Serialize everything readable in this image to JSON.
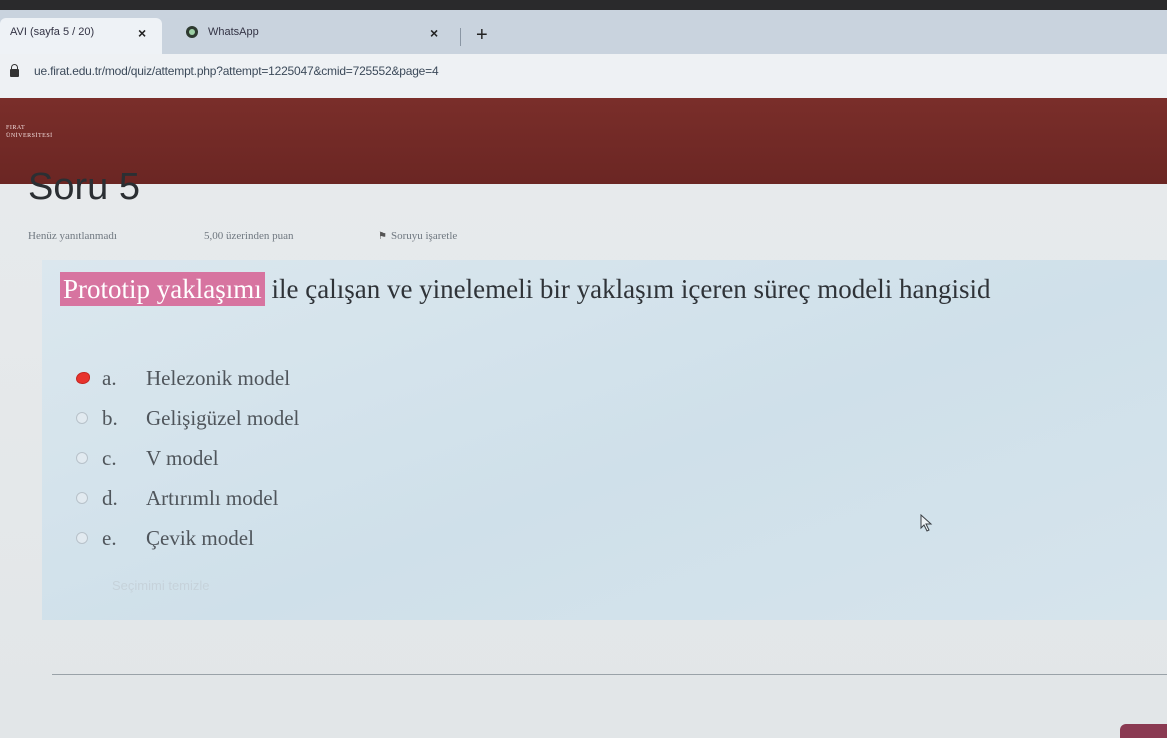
{
  "browser": {
    "tabs": [
      {
        "title": "AVI (sayfa 5 / 20)",
        "active": true
      },
      {
        "title": "WhatsApp",
        "active": false
      }
    ],
    "new_tab_glyph": "+",
    "close_glyph": "×",
    "url": "ue.firat.edu.tr/mod/quiz/attempt.php?attempt=1225047&cmid=725552&page=4"
  },
  "site": {
    "logo_line1": "FIRAT",
    "logo_line2": "ÜNİVERSİTESİ",
    "brand_color": "#7a2e2a"
  },
  "question": {
    "title": "Soru 5",
    "status": "Henüz yanıtlanmadı",
    "points": "5,00 üzerinden puan",
    "flag_label": "Soruyu işaretle",
    "text_highlight": "Prototip yaklaşımı",
    "text_rest": " ile çalışan ve yinelemeli bir yaklaşım içeren süreç modeli hangisid",
    "options": [
      {
        "letter": "a.",
        "label": "Helezonik model",
        "selected": true
      },
      {
        "letter": "b.",
        "label": "Gelişigüzel model",
        "selected": false
      },
      {
        "letter": "c.",
        "label": "V model",
        "selected": false
      },
      {
        "letter": "d.",
        "label": "Artırımlı model",
        "selected": false
      },
      {
        "letter": "e.",
        "label": "Çevik model",
        "selected": false
      }
    ],
    "clear_choice": "Seçimimi temizle",
    "highlight_color": "#d774a0"
  }
}
